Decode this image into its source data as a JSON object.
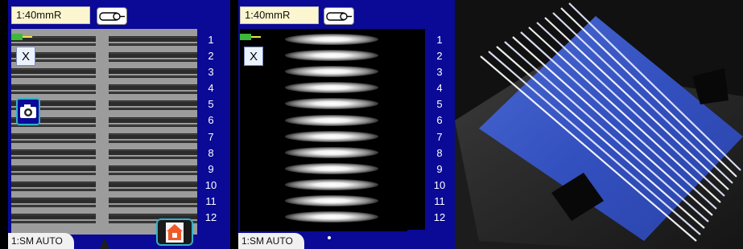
{
  "left_screen": {
    "magnification": "1:40mmR",
    "close_label": "X",
    "mode": "1:SM AUTO",
    "fiber_numbers": [
      "1",
      "2",
      "3",
      "4",
      "5",
      "6",
      "7",
      "8",
      "9",
      "10",
      "11",
      "12"
    ],
    "icons": [
      "fiber-cable-icon",
      "battery-icon",
      "camera-icon",
      "home-icon"
    ]
  },
  "right_screen": {
    "magnification": "1:40mmR",
    "close_label": "X",
    "mode": "1:SM AUTO",
    "fiber_numbers": [
      "1",
      "2",
      "3",
      "4",
      "5",
      "6",
      "7",
      "8",
      "9",
      "10",
      "11",
      "12"
    ],
    "icons": [
      "fiber-cable-icon",
      "battery-icon"
    ]
  },
  "photo": {
    "subject": "ribbon fibers in holder",
    "fiber_count": 12,
    "colors": {
      "holder": "#3c58c4",
      "body": "#2b2b2b"
    }
  },
  "colors": {
    "screen_bg": "#0a0a96",
    "title_bg": "#fbf6cf",
    "accent": "#2fb0c9"
  }
}
